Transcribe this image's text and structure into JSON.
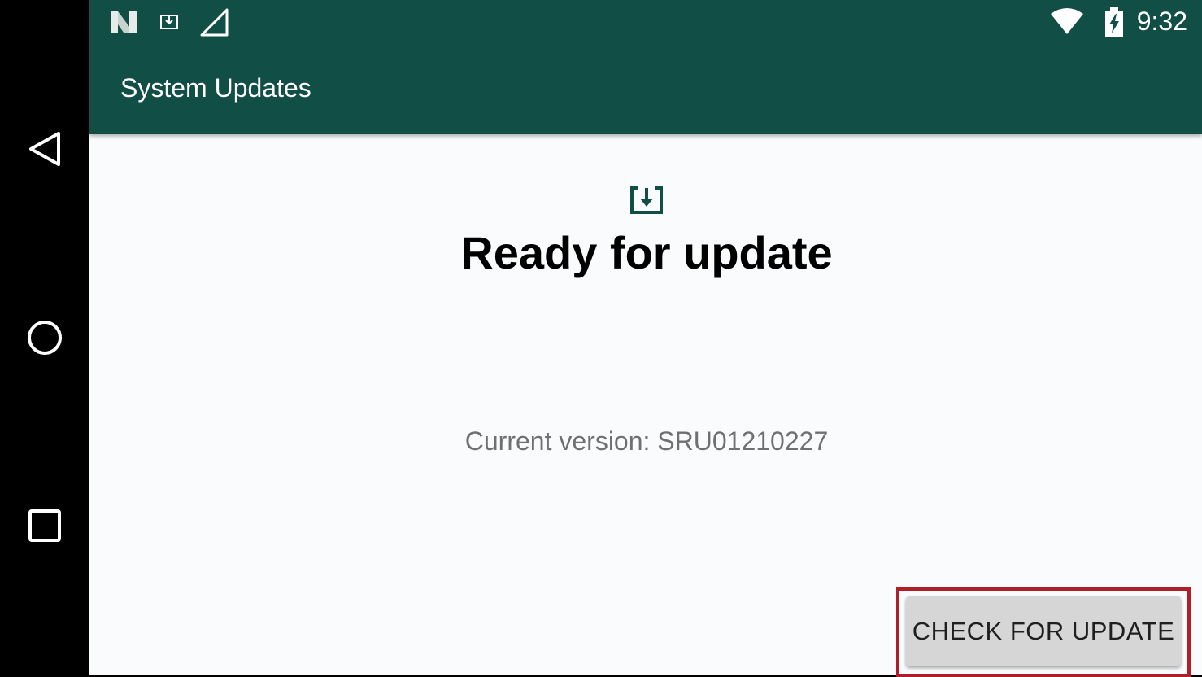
{
  "status_bar": {
    "time": "9:32",
    "icons": [
      "n-logo-icon",
      "download-notification-icon",
      "signal-icon",
      "wifi-icon",
      "battery-charging-icon"
    ]
  },
  "app_bar": {
    "title": "System Updates"
  },
  "main": {
    "icon": "system-update-icon",
    "heading": "Ready for update",
    "current_version": "Current version: SRU01210227"
  },
  "actions": {
    "check_for_update_label": "CHECK FOR UPDATE"
  },
  "navigation": {
    "items": [
      "back-icon",
      "home-icon",
      "recents-icon"
    ]
  },
  "colors": {
    "app_bar": "#114e45",
    "background": "#fafbfc",
    "button": "#d6d6d6",
    "highlight": "#b01e2a"
  }
}
